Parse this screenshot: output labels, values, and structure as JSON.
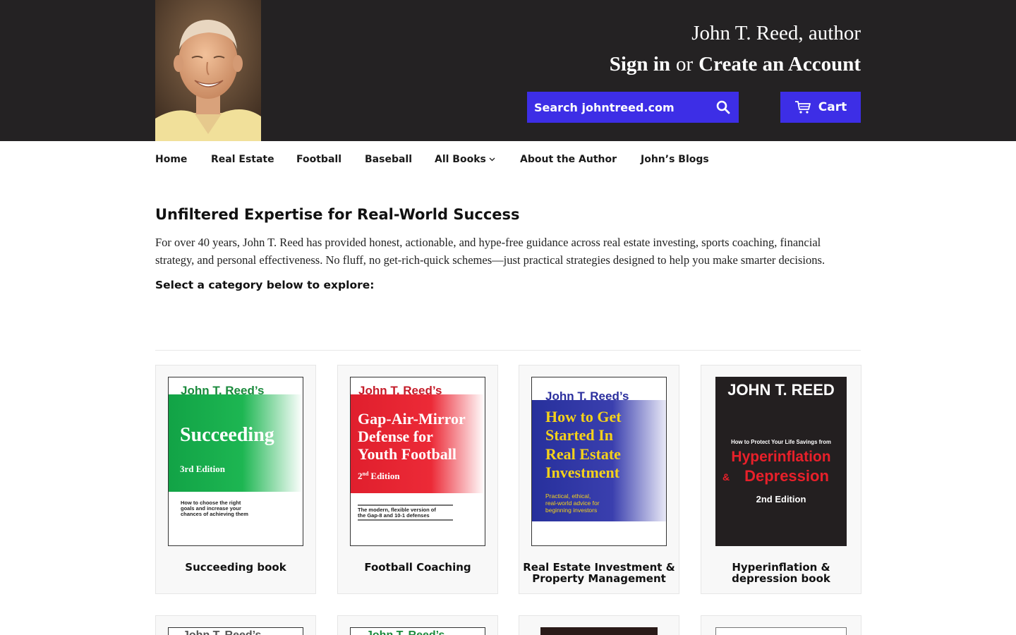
{
  "header": {
    "author_title": "John T. Reed, author",
    "sign_in": "Sign in",
    "or": "or",
    "create_account": "Create an Account",
    "search_placeholder": "Search johntreed.com",
    "cart_label": "Cart"
  },
  "nav": {
    "items": [
      {
        "label": "Home"
      },
      {
        "label": "Real Estate"
      },
      {
        "label": "Football"
      },
      {
        "label": "Baseball"
      },
      {
        "label": "All Books",
        "has_dropdown": true
      },
      {
        "label": "About the Author"
      },
      {
        "label": "John’s Blogs"
      }
    ]
  },
  "intro": {
    "heading": "Unfiltered Expertise for Real-World Success",
    "text": "For over 40 years, John T. Reed has provided honest, actionable, and hype-free guidance across real estate investing, sports coaching, financial strategy, and personal effectiveness. No fluff, no get-rich-quick schemes—just practical strategies designed to help you make smarter decisions.",
    "select_prompt": "Select a category below to explore:"
  },
  "categories": [
    {
      "title": "Succeeding book",
      "cover": {
        "brand": "John T. Reed’s",
        "title_lines": [
          "Succeeding"
        ],
        "edition": "3rd Edition",
        "subtitle_lines": [
          "How to choose the right",
          "goals and increase your",
          "chances of achieving them"
        ],
        "color": "#1aa64a"
      }
    },
    {
      "title": "Football Coaching",
      "cover": {
        "brand": "John T. Reed’s",
        "title_lines": [
          "Gap-Air-Mirror",
          "Defense for",
          "Youth Football"
        ],
        "edition_num": "2",
        "edition_sup": "nd",
        "edition_word": "Edition",
        "subtitle_lines": [
          "The modern, flexible version of",
          "the Gap-8 and 10-1 defenses"
        ],
        "color": "#e3222f"
      }
    },
    {
      "title_lines": [
        "Real Estate Investment &",
        "Property Management"
      ],
      "cover": {
        "brand": "John T. Reed’s",
        "title_lines": [
          "How to Get",
          "Started In",
          "Real Estate",
          "Investment"
        ],
        "subtitle_lines": [
          "Practical, ethical,",
          "real-world advice for",
          "beginning investors"
        ],
        "color": "#2b2f9e",
        "title_color": "#f5d21a"
      }
    },
    {
      "title_lines": [
        "Hyperinflation &",
        "depression book"
      ],
      "cover": {
        "author": "JOHN T. REED",
        "kicker": "How to Protect Your Life Savings from",
        "title_line1": "Hyperinflation",
        "amp": "&",
        "title_line2": "Depression",
        "edition": "2nd Edition",
        "color": "#231f20",
        "title_color": "#e8202a"
      }
    }
  ],
  "second_row_partial": {
    "cover1_brand": "John T. Reed’s",
    "cover2_brand": "John T. Reed’s"
  },
  "colors": {
    "header_bg": "#242223",
    "accent": "#3d2ee6",
    "card_bg": "#f8f8f8"
  }
}
